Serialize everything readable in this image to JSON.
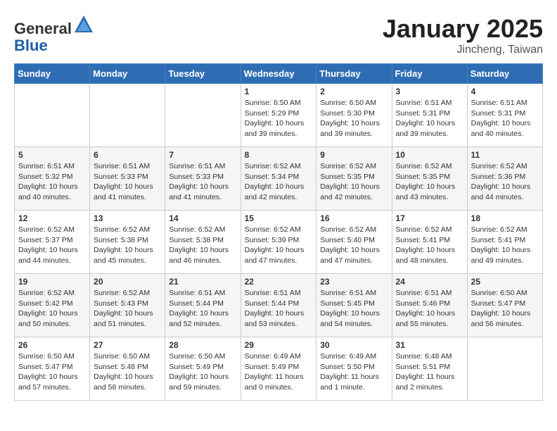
{
  "header": {
    "logo_line1": "General",
    "logo_line2": "Blue",
    "month_title": "January 2025",
    "location": "Jincheng, Taiwan"
  },
  "weekdays": [
    "Sunday",
    "Monday",
    "Tuesday",
    "Wednesday",
    "Thursday",
    "Friday",
    "Saturday"
  ],
  "weeks": [
    [
      {
        "day": "",
        "info": ""
      },
      {
        "day": "",
        "info": ""
      },
      {
        "day": "",
        "info": ""
      },
      {
        "day": "1",
        "info": "Sunrise: 6:50 AM\nSunset: 5:29 PM\nDaylight: 10 hours\nand 39 minutes."
      },
      {
        "day": "2",
        "info": "Sunrise: 6:50 AM\nSunset: 5:30 PM\nDaylight: 10 hours\nand 39 minutes."
      },
      {
        "day": "3",
        "info": "Sunrise: 6:51 AM\nSunset: 5:31 PM\nDaylight: 10 hours\nand 39 minutes."
      },
      {
        "day": "4",
        "info": "Sunrise: 6:51 AM\nSunset: 5:31 PM\nDaylight: 10 hours\nand 40 minutes."
      }
    ],
    [
      {
        "day": "5",
        "info": "Sunrise: 6:51 AM\nSunset: 5:32 PM\nDaylight: 10 hours\nand 40 minutes."
      },
      {
        "day": "6",
        "info": "Sunrise: 6:51 AM\nSunset: 5:33 PM\nDaylight: 10 hours\nand 41 minutes."
      },
      {
        "day": "7",
        "info": "Sunrise: 6:51 AM\nSunset: 5:33 PM\nDaylight: 10 hours\nand 41 minutes."
      },
      {
        "day": "8",
        "info": "Sunrise: 6:52 AM\nSunset: 5:34 PM\nDaylight: 10 hours\nand 42 minutes."
      },
      {
        "day": "9",
        "info": "Sunrise: 6:52 AM\nSunset: 5:35 PM\nDaylight: 10 hours\nand 42 minutes."
      },
      {
        "day": "10",
        "info": "Sunrise: 6:52 AM\nSunset: 5:35 PM\nDaylight: 10 hours\nand 43 minutes."
      },
      {
        "day": "11",
        "info": "Sunrise: 6:52 AM\nSunset: 5:36 PM\nDaylight: 10 hours\nand 44 minutes."
      }
    ],
    [
      {
        "day": "12",
        "info": "Sunrise: 6:52 AM\nSunset: 5:37 PM\nDaylight: 10 hours\nand 44 minutes."
      },
      {
        "day": "13",
        "info": "Sunrise: 6:52 AM\nSunset: 5:38 PM\nDaylight: 10 hours\nand 45 minutes."
      },
      {
        "day": "14",
        "info": "Sunrise: 6:52 AM\nSunset: 5:38 PM\nDaylight: 10 hours\nand 46 minutes."
      },
      {
        "day": "15",
        "info": "Sunrise: 6:52 AM\nSunset: 5:39 PM\nDaylight: 10 hours\nand 47 minutes."
      },
      {
        "day": "16",
        "info": "Sunrise: 6:52 AM\nSunset: 5:40 PM\nDaylight: 10 hours\nand 47 minutes."
      },
      {
        "day": "17",
        "info": "Sunrise: 6:52 AM\nSunset: 5:41 PM\nDaylight: 10 hours\nand 48 minutes."
      },
      {
        "day": "18",
        "info": "Sunrise: 6:52 AM\nSunset: 5:41 PM\nDaylight: 10 hours\nand 49 minutes."
      }
    ],
    [
      {
        "day": "19",
        "info": "Sunrise: 6:52 AM\nSunset: 5:42 PM\nDaylight: 10 hours\nand 50 minutes."
      },
      {
        "day": "20",
        "info": "Sunrise: 6:52 AM\nSunset: 5:43 PM\nDaylight: 10 hours\nand 51 minutes."
      },
      {
        "day": "21",
        "info": "Sunrise: 6:51 AM\nSunset: 5:44 PM\nDaylight: 10 hours\nand 52 minutes."
      },
      {
        "day": "22",
        "info": "Sunrise: 6:51 AM\nSunset: 5:44 PM\nDaylight: 10 hours\nand 53 minutes."
      },
      {
        "day": "23",
        "info": "Sunrise: 6:51 AM\nSunset: 5:45 PM\nDaylight: 10 hours\nand 54 minutes."
      },
      {
        "day": "24",
        "info": "Sunrise: 6:51 AM\nSunset: 5:46 PM\nDaylight: 10 hours\nand 55 minutes."
      },
      {
        "day": "25",
        "info": "Sunrise: 6:50 AM\nSunset: 5:47 PM\nDaylight: 10 hours\nand 56 minutes."
      }
    ],
    [
      {
        "day": "26",
        "info": "Sunrise: 6:50 AM\nSunset: 5:47 PM\nDaylight: 10 hours\nand 57 minutes."
      },
      {
        "day": "27",
        "info": "Sunrise: 6:50 AM\nSunset: 5:48 PM\nDaylight: 10 hours\nand 58 minutes."
      },
      {
        "day": "28",
        "info": "Sunrise: 6:50 AM\nSunset: 5:49 PM\nDaylight: 10 hours\nand 59 minutes."
      },
      {
        "day": "29",
        "info": "Sunrise: 6:49 AM\nSunset: 5:49 PM\nDaylight: 11 hours\nand 0 minutes."
      },
      {
        "day": "30",
        "info": "Sunrise: 6:49 AM\nSunset: 5:50 PM\nDaylight: 11 hours\nand 1 minute."
      },
      {
        "day": "31",
        "info": "Sunrise: 6:48 AM\nSunset: 5:51 PM\nDaylight: 11 hours\nand 2 minutes."
      },
      {
        "day": "",
        "info": ""
      }
    ]
  ]
}
